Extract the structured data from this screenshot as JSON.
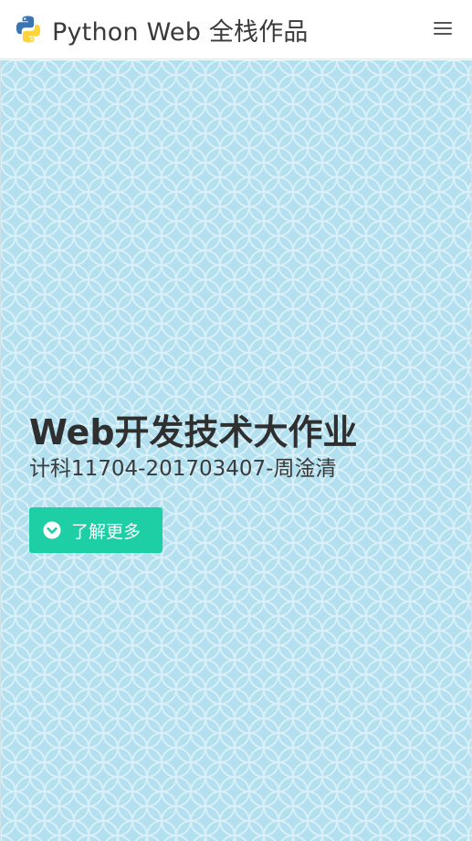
{
  "navbar": {
    "brand_logo_icon": "python-logo-icon",
    "brand_text": "Python Web 全栈作品",
    "menu_icon": "hamburger-menu-icon"
  },
  "hero": {
    "title": "Web开发技术大作业",
    "subtitle": "计科11704-201703407-周淦清",
    "button": {
      "icon": "chevron-down-circle-icon",
      "label": "了解更多"
    }
  },
  "colors": {
    "hero_background": "#b3e0ef",
    "pattern_lines": "#dcf1f8",
    "button_accent": "#1ecfa6",
    "heading_text": "#2f2f2f",
    "python_blue": "#3a75b0",
    "python_yellow": "#ffd43b"
  }
}
